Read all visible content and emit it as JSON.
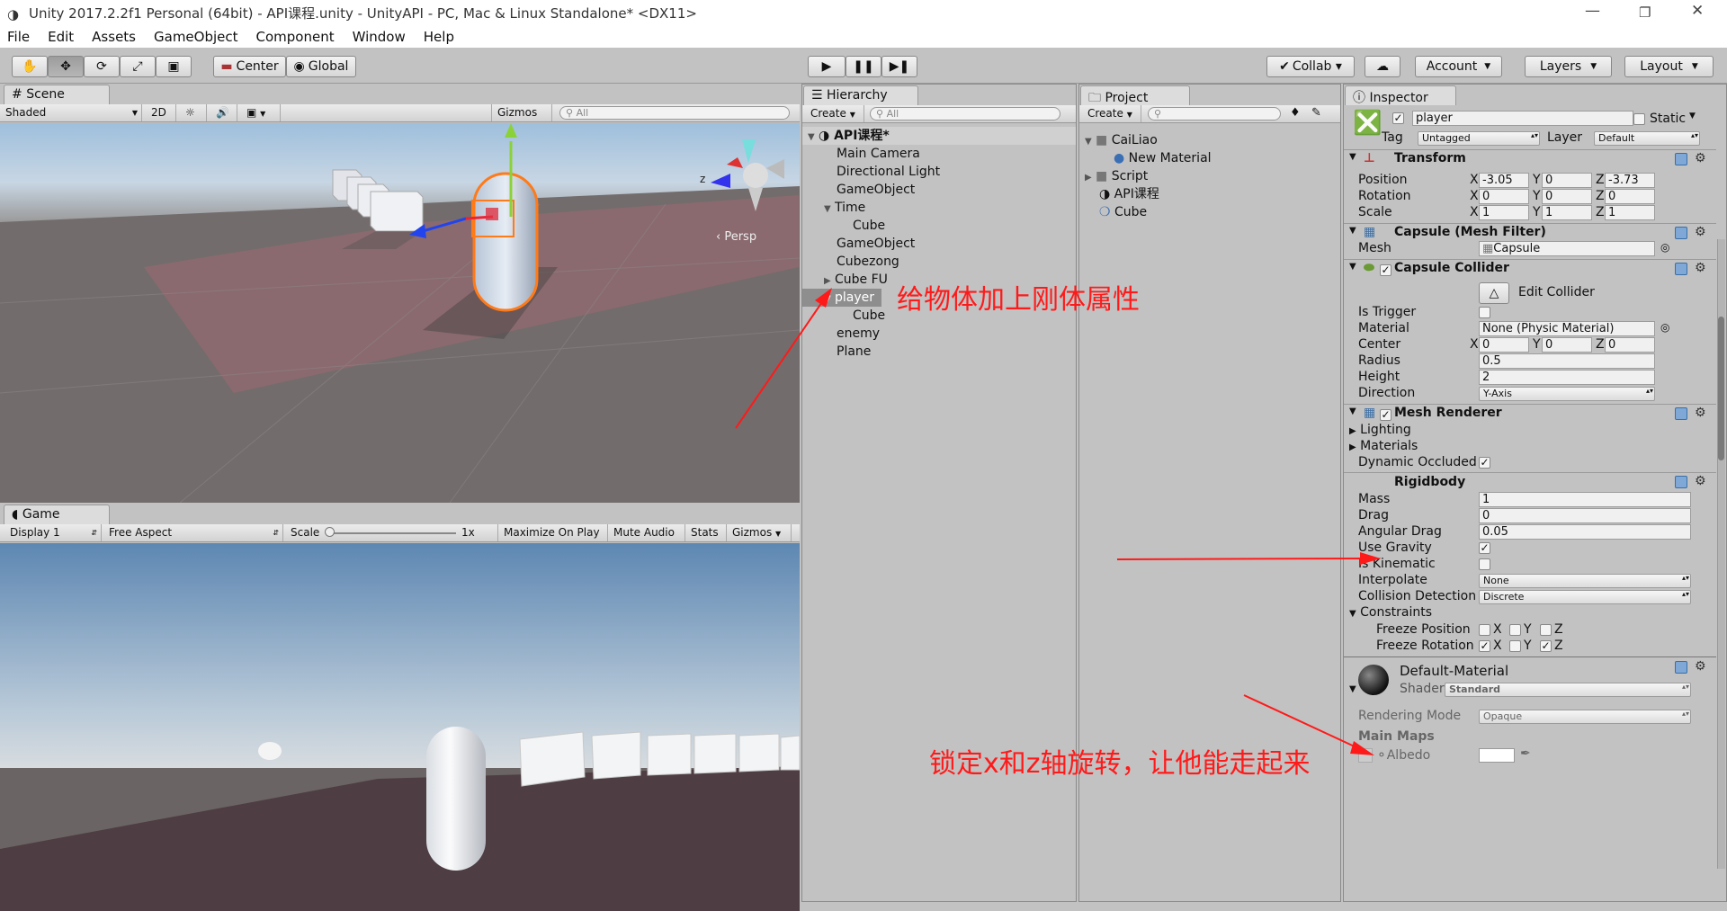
{
  "window": {
    "title": "Unity 2017.2.2f1 Personal (64bit) - API课程.unity - UnityAPI - PC, Mac & Linux Standalone* <DX11>",
    "min": "—",
    "max": "❐",
    "close": "✕"
  },
  "menu": [
    "File",
    "Edit",
    "Assets",
    "GameObject",
    "Component",
    "Window",
    "Help"
  ],
  "toolbar": {
    "center": "Center",
    "global": "Global",
    "collab": "Collab ▾",
    "account": "Account",
    "layers": "Layers",
    "layout": "Layout"
  },
  "scene": {
    "tab": "Scene",
    "shaded": "Shaded",
    "mode2d": "2D",
    "gizmos": "Gizmos",
    "search_placeholder": "All",
    "persp": "‹ Persp",
    "axis_z": "z"
  },
  "game": {
    "tab": "Game",
    "display": "Display 1",
    "aspect": "Free Aspect",
    "scale_label": "Scale",
    "scale_value": "1x",
    "maximize": "Maximize On Play",
    "mute": "Mute Audio",
    "stats": "Stats",
    "gizmos": "Gizmos"
  },
  "hierarchy": {
    "tab": "Hierarchy",
    "create": "Create",
    "search_placeholder": "All",
    "scene_name": "API课程*",
    "items": [
      "Main Camera",
      "Directional Light",
      "GameObject",
      "Time",
      "Cube",
      "GameObject",
      "Cubezong",
      "Cube FU",
      "player",
      "Cube",
      "enemy",
      "Plane"
    ]
  },
  "project": {
    "tab": "Project",
    "create": "Create",
    "items": [
      "CaiLiao",
      "New Material",
      "Script",
      "API课程",
      "Cube"
    ]
  },
  "inspector": {
    "tab": "Inspector",
    "name": "player",
    "static": "Static",
    "tag_label": "Tag",
    "tag": "Untagged",
    "layer_label": "Layer",
    "layer": "Default",
    "transform": {
      "title": "Transform",
      "position": "Position",
      "rotation": "Rotation",
      "scale": "Scale",
      "px": "-3.05",
      "py": "0",
      "pz": "-3.73",
      "rx": "0",
      "ry": "0",
      "rz": "0",
      "sx": "1",
      "sy": "1",
      "sz": "1"
    },
    "meshfilter": {
      "title": "Capsule (Mesh Filter)",
      "mesh_label": "Mesh",
      "mesh": "Capsule"
    },
    "collider": {
      "title": "Capsule Collider",
      "edit": "Edit Collider",
      "is_trigger": "Is Trigger",
      "material_label": "Material",
      "material": "None (Physic Material)",
      "center": "Center",
      "cx": "0",
      "cy": "0",
      "cz": "0",
      "radius_label": "Radius",
      "radius": "0.5",
      "height_label": "Height",
      "height": "2",
      "direction_label": "Direction",
      "direction": "Y-Axis"
    },
    "renderer": {
      "title": "Mesh Renderer",
      "lighting": "Lighting",
      "materials": "Materials",
      "dynamic": "Dynamic Occluded"
    },
    "rigidbody": {
      "title": "Rigidbody",
      "mass_label": "Mass",
      "mass": "1",
      "drag_label": "Drag",
      "drag": "0",
      "adrag_label": "Angular Drag",
      "adrag": "0.05",
      "gravity": "Use Gravity",
      "kinematic": "Is Kinematic",
      "interp_label": "Interpolate",
      "interp": "None",
      "collision_label": "Collision Detection",
      "collision": "Discrete",
      "constraints": "Constraints",
      "freeze_pos": "Freeze Position",
      "freeze_rot": "Freeze Rotation",
      "x": "X",
      "y": "Y",
      "z": "Z"
    },
    "material": {
      "name": "Default-Material",
      "shader_label": "Shader",
      "shader": "Standard",
      "rendering_label": "Rendering Mode",
      "rendering": "Opaque",
      "maps": "Main Maps",
      "albedo": "Albedo"
    }
  },
  "annotations": {
    "rigidbody_note": "给物体加上刚体属性",
    "freeze_note": "锁定x和z轴旋转，让他能走起来"
  },
  "colors": {
    "annotation": "#ff1a1a",
    "selected": "#8e8e8e",
    "accent": "#3a6ea5"
  }
}
